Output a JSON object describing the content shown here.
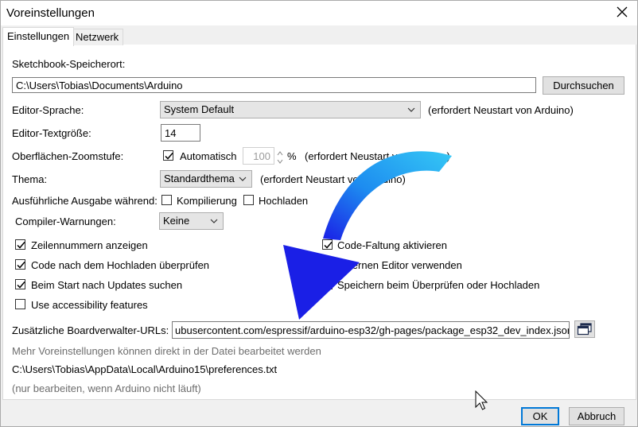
{
  "window": {
    "title": "Voreinstellungen"
  },
  "tabs": [
    "Einstellungen",
    "Netzwerk"
  ],
  "sketchbook": {
    "label": "Sketchbook-Speicherort:",
    "path": "C:\\Users\\Tobias\\Documents\\Arduino",
    "browse": "Durchsuchen"
  },
  "language": {
    "label": "Editor-Sprache:",
    "value": "System Default",
    "note": "(erfordert Neustart von Arduino)"
  },
  "fontsize": {
    "label": "Editor-Textgröße:",
    "value": "14"
  },
  "zoom": {
    "label": "Oberflächen-Zoomstufe:",
    "auto_label": "Automatisch",
    "auto_checked": true,
    "value": "100",
    "unit": "%",
    "note": "(erfordert Neustart von Arduino)"
  },
  "theme": {
    "label": "Thema:",
    "value": "Standardthema",
    "note": "(erfordert Neustart von Arduino)"
  },
  "verbose": {
    "label": "Ausführliche Ausgabe während:",
    "compile_label": "Kompilierung",
    "compile_checked": false,
    "upload_label": "Hochladen",
    "upload_checked": false
  },
  "warnings": {
    "label": "Compiler-Warnungen:",
    "value": "Keine"
  },
  "options_left": [
    {
      "label": "Zeilennummern anzeigen",
      "checked": true
    },
    {
      "label": "Code nach dem Hochladen überprüfen",
      "checked": true
    },
    {
      "label": "Beim Start nach Updates suchen",
      "checked": true
    },
    {
      "label": "Use accessibility features",
      "checked": false
    }
  ],
  "options_right": [
    {
      "label": "Code-Faltung aktivieren",
      "checked": true
    },
    {
      "label": "Externen Editor verwenden",
      "checked": false
    },
    {
      "label": "Speichern beim Überprüfen oder Hochladen",
      "checked": true
    }
  ],
  "boards": {
    "label": "Zusätzliche Boardverwalter-URLs:",
    "value": "ubusercontent.com/espressif/arduino-esp32/gh-pages/package_esp32_dev_index.json"
  },
  "info": {
    "more": "Mehr Voreinstellungen können direkt in der Datei bearbeitet werden",
    "file": "C:\\Users\\Tobias\\AppData\\Local\\Arduino15\\preferences.txt",
    "hint": "(nur bearbeiten, wenn Arduino nicht läuft)"
  },
  "buttons": {
    "ok": "OK",
    "cancel": "Abbruch"
  },
  "colors": {
    "arrow_light": "#35c8f5",
    "arrow_dark": "#1a1fe6",
    "focus": "#0078d7"
  },
  "icons": {
    "close": "close-icon",
    "chevron": "chevron-down-icon",
    "check": "check-icon",
    "window": "window-icon",
    "cursor": "mouse-pointer-icon"
  }
}
